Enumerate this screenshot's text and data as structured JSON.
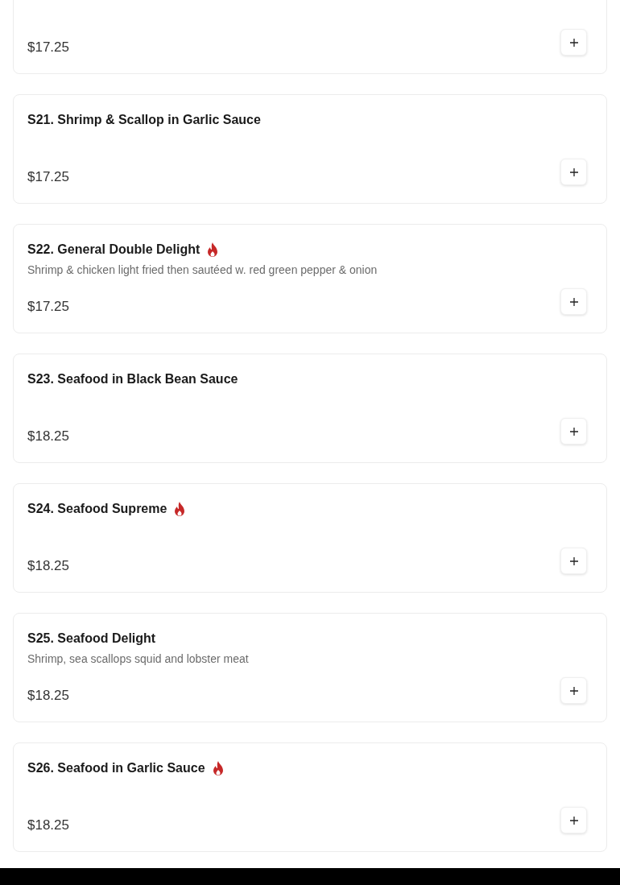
{
  "items": [
    {
      "price": "$17.25"
    },
    {
      "title": "S21. Shrimp & Scallop in Garlic Sauce",
      "spicy": false,
      "price": "$17.25"
    },
    {
      "title": "S22. General Double Delight",
      "spicy": true,
      "description": "Shrimp & chicken light fried then sautéed w. red green pepper & onion",
      "price": "$17.25"
    },
    {
      "title": "S23. Seafood in Black Bean Sauce",
      "spicy": false,
      "price": "$18.25"
    },
    {
      "title": "S24. Seafood Supreme",
      "spicy": true,
      "price": "$18.25"
    },
    {
      "title": "S25. Seafood Delight",
      "spicy": false,
      "description": "Shrimp, sea scallops squid and lobster meat",
      "price": "$18.25"
    },
    {
      "title": "S26. Seafood in Garlic Sauce",
      "spicy": true,
      "price": "$18.25"
    }
  ]
}
